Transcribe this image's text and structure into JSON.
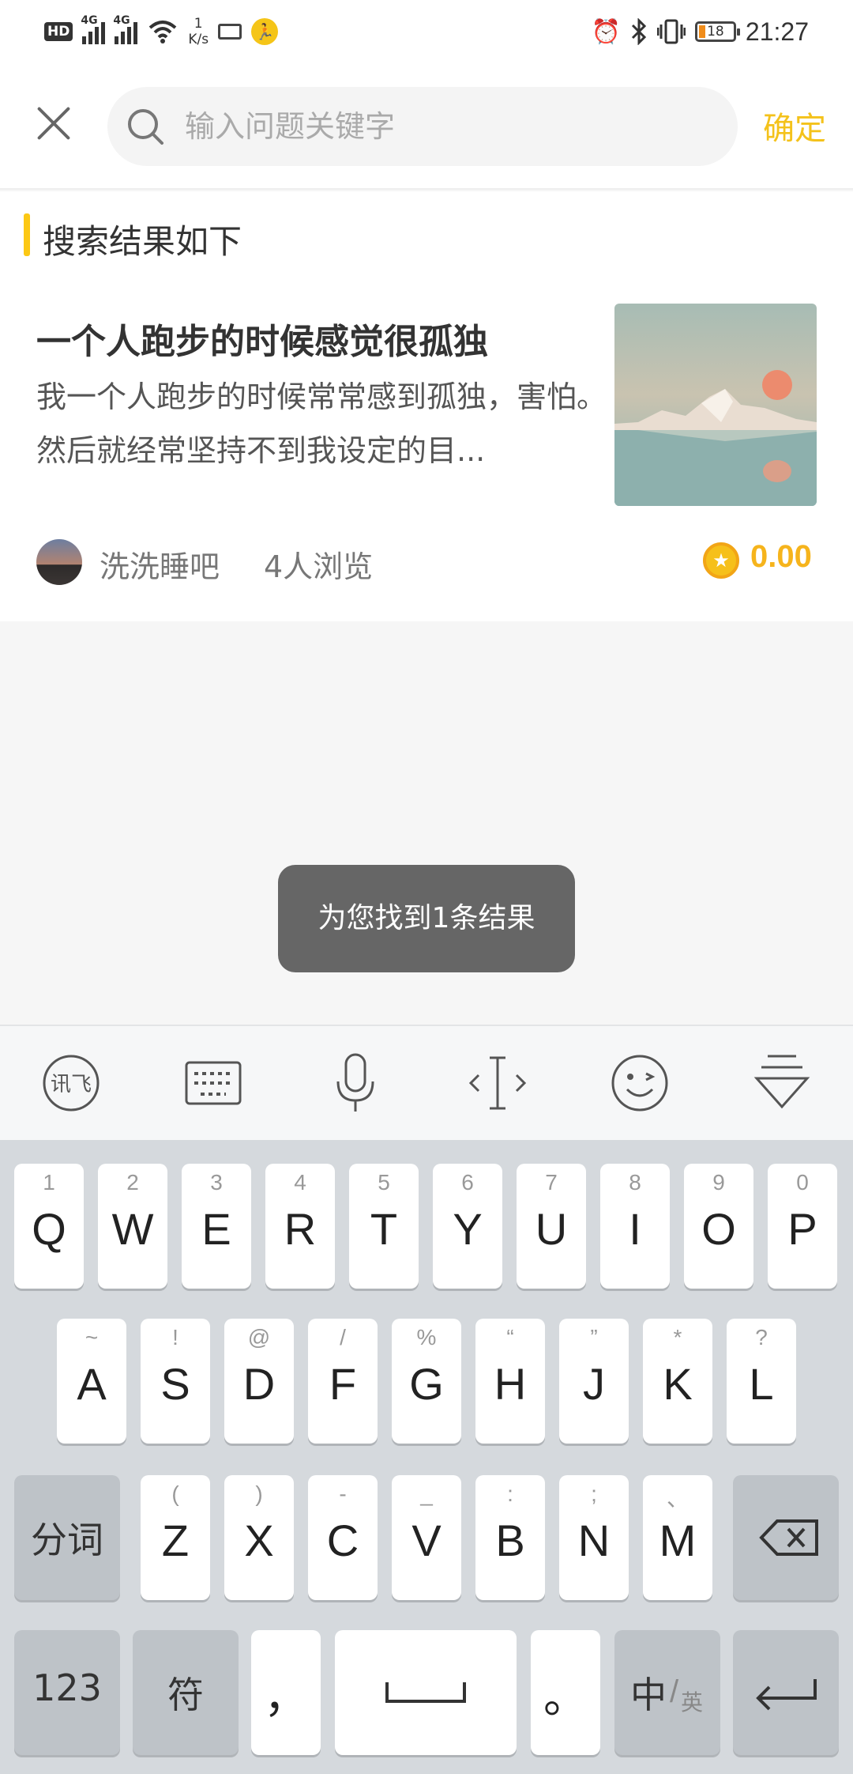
{
  "status_bar": {
    "hd": "HD",
    "network_1": "4G",
    "network_2": "4G",
    "speed_value": "1",
    "speed_unit": "K/s",
    "battery": "18",
    "time": "21:27"
  },
  "search": {
    "placeholder": "输入问题关键字",
    "confirm_label": "确定"
  },
  "results": {
    "section_title": "搜索结果如下",
    "items": [
      {
        "title": "一个人跑步的时候感觉很孤独",
        "excerpt": "我一个人跑步的时候常常感到孤独，害怕。然后就经常坚持不到我设定的目...",
        "author": "洗洗睡吧",
        "views": "4人浏览",
        "reward": "0.00"
      }
    ]
  },
  "toast": "为您找到1条结果",
  "ime_toolbar": [
    "xunfei-logo-icon",
    "keyboard-icon",
    "microphone-icon",
    "cursor-move-icon",
    "emoji-icon",
    "hide-keyboard-icon"
  ],
  "keyboard": {
    "row1": [
      {
        "key": "Q",
        "hint": "1"
      },
      {
        "key": "W",
        "hint": "2"
      },
      {
        "key": "E",
        "hint": "3"
      },
      {
        "key": "R",
        "hint": "4"
      },
      {
        "key": "T",
        "hint": "5"
      },
      {
        "key": "Y",
        "hint": "6"
      },
      {
        "key": "U",
        "hint": "7"
      },
      {
        "key": "I",
        "hint": "8"
      },
      {
        "key": "O",
        "hint": "9"
      },
      {
        "key": "P",
        "hint": "0"
      }
    ],
    "row2": [
      {
        "key": "A",
        "hint": "~"
      },
      {
        "key": "S",
        "hint": "!"
      },
      {
        "key": "D",
        "hint": "@"
      },
      {
        "key": "F",
        "hint": "/"
      },
      {
        "key": "G",
        "hint": "%"
      },
      {
        "key": "H",
        "hint": "“"
      },
      {
        "key": "J",
        "hint": "”"
      },
      {
        "key": "K",
        "hint": "*"
      },
      {
        "key": "L",
        "hint": "?"
      }
    ],
    "row3": [
      {
        "key": "Z",
        "hint": "("
      },
      {
        "key": "X",
        "hint": ")"
      },
      {
        "key": "C",
        "hint": "-"
      },
      {
        "key": "V",
        "hint": "_"
      },
      {
        "key": "B",
        "hint": ":"
      },
      {
        "key": "N",
        "hint": ";"
      },
      {
        "key": "M",
        "hint": "、"
      }
    ],
    "segment_label": "分词",
    "num_label": "123",
    "symbol_label": "符",
    "comma_label": "，",
    "period_label": "。",
    "lang_main": "中",
    "lang_alt": "英"
  }
}
